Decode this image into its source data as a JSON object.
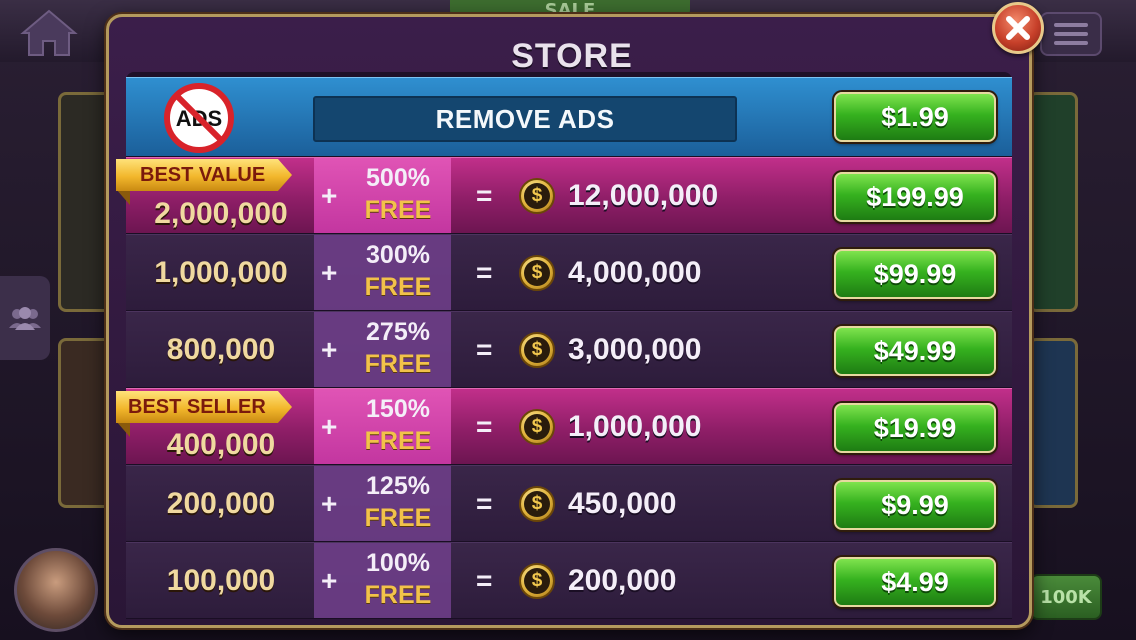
{
  "background": {
    "sale_label": "SALE",
    "right_button_label": "100K"
  },
  "dialog": {
    "title": "STORE"
  },
  "remove_ads": {
    "icon_text": "ADS",
    "label": "REMOVE ADS",
    "price": "$1.99"
  },
  "packages": [
    {
      "ribbon": "BEST VALUE",
      "base": "2,000,000",
      "bonus": "500%",
      "free": "FREE",
      "total": "12,000,000",
      "price": "$199.99",
      "highlight": true
    },
    {
      "ribbon": "",
      "base": "1,000,000",
      "bonus": "300%",
      "free": "FREE",
      "total": "4,000,000",
      "price": "$99.99",
      "highlight": false
    },
    {
      "ribbon": "",
      "base": "800,000",
      "bonus": "275%",
      "free": "FREE",
      "total": "3,000,000",
      "price": "$49.99",
      "highlight": false
    },
    {
      "ribbon": "BEST SELLER",
      "base": "400,000",
      "bonus": "150%",
      "free": "FREE",
      "total": "1,000,000",
      "price": "$19.99",
      "highlight": true
    },
    {
      "ribbon": "",
      "base": "200,000",
      "bonus": "125%",
      "free": "FREE",
      "total": "450,000",
      "price": "$9.99",
      "highlight": false
    },
    {
      "ribbon": "",
      "base": "100,000",
      "bonus": "100%",
      "free": "FREE",
      "total": "200,000",
      "price": "$4.99",
      "highlight": false
    }
  ],
  "symbols": {
    "plus": "+",
    "equals": "=",
    "coin": "$"
  },
  "icons": {
    "close": "close-icon",
    "home": "home-icon",
    "menu": "menu-icon",
    "friends": "friends-icon",
    "coin": "coin-icon",
    "no_ads": "no-ads-icon"
  },
  "colors": {
    "price_button": "#36b21f",
    "highlight_row": "#c12f8a",
    "ads_row": "#2f8fd0",
    "free_text": "#f2c24a",
    "base_amount": "#f0d9a0"
  }
}
